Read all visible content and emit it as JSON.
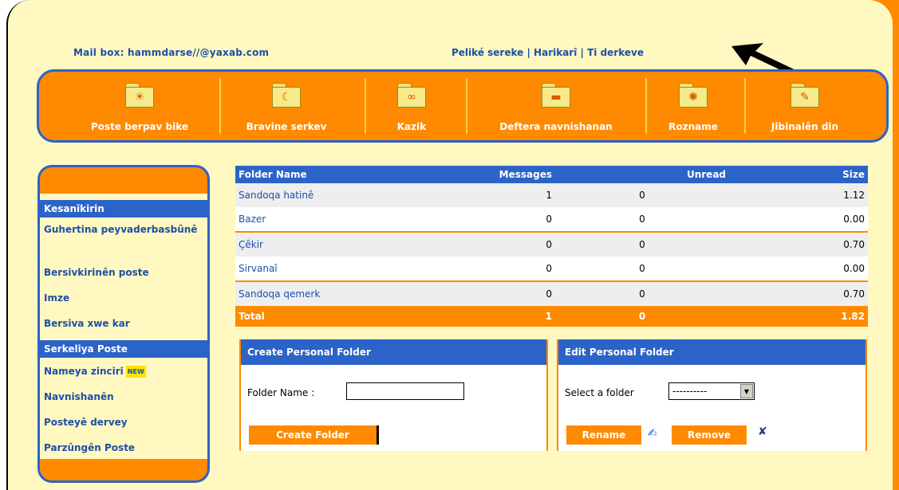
{
  "header": {
    "mailbox_label": "Mail box: hammdarse//@yaxab.com",
    "links": [
      {
        "label": "Peliké sereke"
      },
      {
        "label": "Harikarî"
      },
      {
        "label": "Ti derkeve"
      }
    ],
    "link_separator": "|"
  },
  "nav": {
    "items": [
      {
        "label": "Poste berpav bike",
        "icon": "sun-folder-icon",
        "glyph": "☀"
      },
      {
        "label": "Bravine serkev",
        "icon": "moon-folder-icon",
        "glyph": "☾"
      },
      {
        "label": "Kazik",
        "icon": "pattern-folder-icon",
        "glyph": "∞"
      },
      {
        "label": "Deftera navnishanan",
        "icon": "book-folder-icon",
        "glyph": "▬"
      },
      {
        "label": "Rozname",
        "icon": "calendar-folder-icon",
        "glyph": "✺"
      },
      {
        "label": "Jibinalên din",
        "icon": "wrench-folder-icon",
        "glyph": "✎"
      }
    ]
  },
  "sidebar": {
    "items": [
      {
        "label": "Kesanîkirin"
      },
      {
        "label": "Guhertina peyvaderbasbûnê"
      },
      {
        "label": "Bersivkirinên poste"
      },
      {
        "label": "Imze"
      },
      {
        "label": "Bersiva xwe kar"
      },
      {
        "label": "Serkeliya Poste"
      },
      {
        "label": "Nameya zinciri",
        "badge": "NEW"
      },
      {
        "label": "Navnishanên"
      },
      {
        "label": "Posteyê dervey"
      },
      {
        "label": "Parzûngên Poste"
      }
    ],
    "active_index": 5
  },
  "folders_table": {
    "columns": [
      "Folder Name",
      "Messages",
      "Unread",
      "Size"
    ],
    "rows": [
      {
        "name": "Sandoqa hatinê",
        "messages": "1",
        "unread": "0",
        "size": "1.12"
      },
      {
        "name": "Bazer",
        "messages": "0",
        "unread": "0",
        "size": "0.00"
      },
      {
        "name": "Çêkir",
        "messages": "0",
        "unread": "0",
        "size": "0.70"
      },
      {
        "name": "Sirvanaî",
        "messages": "0",
        "unread": "0",
        "size": "0.00"
      },
      {
        "name": "Sandoqa qemerk",
        "messages": "0",
        "unread": "0",
        "size": "0.70"
      }
    ],
    "total": {
      "label": "Total",
      "messages": "1",
      "unread": "0",
      "size": "1.82"
    }
  },
  "create_panel": {
    "title": "Create Personal Folder",
    "field_label": "Folder Name :",
    "field_value": "",
    "button_label": "Create Folder"
  },
  "edit_panel": {
    "title": "Edit Personal Folder",
    "select_label": "Select a folder",
    "select_value": "----------",
    "rename_button_label": "Rename",
    "remove_button_label": "Remove"
  },
  "colors": {
    "orange": "#ff8a00",
    "blue": "#2c63c8",
    "link_blue": "#1d4fa8",
    "cream": "#fff8c0"
  }
}
